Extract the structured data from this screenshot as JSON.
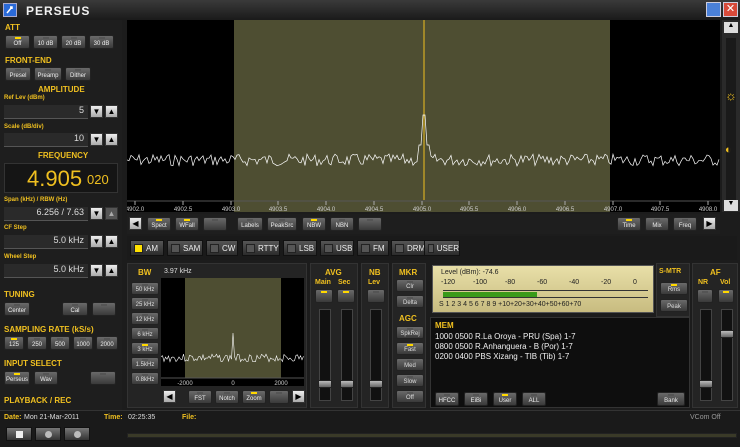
{
  "app": {
    "title": "PERSEUS"
  },
  "left": {
    "att_title": "ATT",
    "att": [
      "Off",
      "10 dB",
      "20 dB",
      "30 dB"
    ],
    "frontend_title": "FRONT-END",
    "frontend": [
      "Presel",
      "Preamp",
      "Dither"
    ],
    "amplitude_title": "AMPLITUDE",
    "ref_label": "Ref Lev (dBm)",
    "ref_value": "5",
    "scale_label": "Scale (dB/div)",
    "scale_value": "10",
    "frequency_title": "FREQUENCY",
    "freq_main": "4.905",
    "freq_small": "020",
    "span_label": "Span (kHz) / RBW (Hz)",
    "span_value": "6.256 / 7.63",
    "cf_label": "CF Step",
    "cf_value": "5.0 kHz",
    "wheel_label": "Wheel Step",
    "wheel_value": "5.0 kHz",
    "tuning_title": "TUNING",
    "center": "Center",
    "cal": "Cal",
    "sampling_title": "SAMPLING RATE (kS/s)",
    "rates": [
      "125",
      "250",
      "500",
      "1000",
      "2000"
    ],
    "input_title": "INPUT SELECT",
    "inputs": [
      "Perseus",
      "Wav"
    ],
    "playback_title": "PLAYBACK / REC"
  },
  "spectrum": {
    "x_ticks": [
      "4902.0",
      "4902.5",
      "4903.0",
      "4903.5",
      "4904.0",
      "4904.5",
      "4905.0",
      "4905.5",
      "4906.0",
      "4906.5",
      "4907.0",
      "4907.5",
      "4908.0"
    ],
    "buttons": [
      "Spect",
      "WFall",
      "",
      "Labels",
      "PeakSrc",
      "NBW",
      "NBN",
      ""
    ],
    "right_buttons": [
      "Time",
      "Mix",
      "Freq"
    ]
  },
  "modes": [
    "AM",
    "SAM",
    "CW",
    "RTTY",
    "LSB",
    "USB",
    "FM",
    "DRM",
    "USER"
  ],
  "bw": {
    "title": "BW",
    "items": [
      "50 kHz",
      "25 kHz",
      "12 kHz",
      "6 kHz",
      "3 kHz",
      "1.5kHz",
      "0.8kHz"
    ],
    "value": "3.97 kHz",
    "ticks": [
      "-2000",
      "0",
      "2000"
    ],
    "buttons": [
      "FST",
      "Notch",
      "Zoom"
    ]
  },
  "avg": {
    "title": "AVG",
    "main": "Main",
    "sec": "Sec"
  },
  "nb": {
    "title": "NB",
    "lev": "Lev"
  },
  "mkr": {
    "title": "MKR",
    "clr": "Clr",
    "delta": "Delta"
  },
  "agc": {
    "title": "AGC",
    "items": [
      "SpkRej",
      "Fast",
      "Med",
      "Slow",
      "Off"
    ]
  },
  "smeter": {
    "level": "Level (dBm): -74.6",
    "top": [
      "-120",
      "-100",
      "-80",
      "-60",
      "-40",
      "-20",
      "0"
    ],
    "bottom": "S 1 2 3 4 5 6 7 8 9 +10+20+30+40+50+60+70",
    "title": "S-MTR",
    "rms": "Rms",
    "peak": "Peak",
    "level_frac": 0.46
  },
  "af": {
    "title": "AF",
    "nr": "NR",
    "vol": "Vol"
  },
  "mem": {
    "title": "MEM",
    "rows": [
      "1000 0500 R.La Oroya - PRU (Spa)  1-7",
      "0800 0500 R.Anhanguera - B (Por)  1-7",
      "0200 0400 PBS Xizang - TIB (Tib)  1-7"
    ],
    "buttons": [
      "HFCC",
      "EiBi",
      "User",
      "ALL"
    ],
    "bank": "Bank"
  },
  "status": {
    "date_label": "Date:",
    "date": "Mon 21-Mar-2011",
    "time_label": "Time:",
    "time": "02:25:35",
    "file_label": "File:",
    "vcom": "VCom Off"
  },
  "colors": {
    "accent": "#f0c020",
    "trace": "#ffffff",
    "band": "#5a5a3a",
    "led": "#ffd800"
  }
}
